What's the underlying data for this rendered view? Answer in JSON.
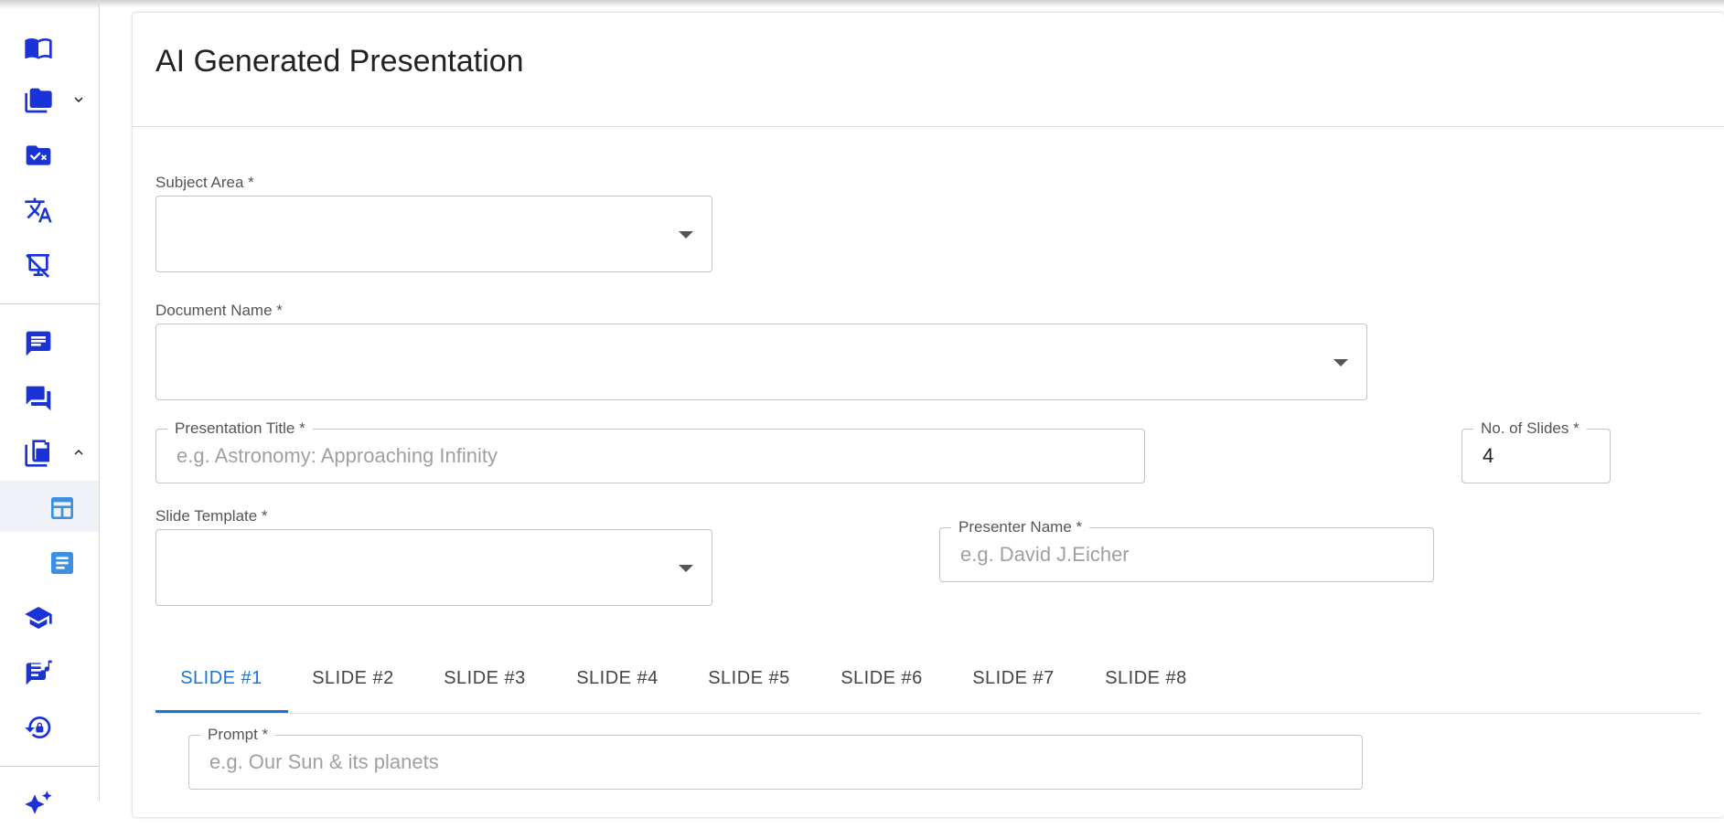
{
  "page": {
    "title": "AI Generated Presentation"
  },
  "form": {
    "subject_area": {
      "label": "Subject Area *",
      "value": ""
    },
    "document_name": {
      "label": "Document Name *",
      "value": ""
    },
    "presentation_title": {
      "label": "Presentation Title *",
      "placeholder": "e.g. Astronomy: Approaching Infinity",
      "value": ""
    },
    "num_slides": {
      "label": "No. of Slides *",
      "value": "4"
    },
    "slide_template": {
      "label": "Slide Template *",
      "value": ""
    },
    "presenter_name": {
      "label": "Presenter Name *",
      "placeholder": "e.g. David J.Eicher",
      "value": ""
    },
    "prompt": {
      "label": "Prompt *",
      "placeholder": "e.g. Our Sun & its planets",
      "value": ""
    }
  },
  "tabs": [
    {
      "label": "SLIDE #1",
      "active": true
    },
    {
      "label": "SLIDE #2"
    },
    {
      "label": "SLIDE #3"
    },
    {
      "label": "SLIDE #4"
    },
    {
      "label": "SLIDE #5"
    },
    {
      "label": "SLIDE #6"
    },
    {
      "label": "SLIDE #7"
    },
    {
      "label": "SLIDE #8"
    }
  ],
  "sidebar": {
    "icons": [
      "book-open-icon",
      "folders-icon",
      "folder-check-icon",
      "translate-icon",
      "presentation-off-icon",
      "chat-icon",
      "forum-icon",
      "library-icon",
      "slide-template-icon",
      "document-icon",
      "graduation-cap-icon",
      "music-chat-icon",
      "lock-reset-icon",
      "sparkle-icon"
    ]
  },
  "colors": {
    "accent": "#1976d2",
    "sidebar_icon": "#1a33d6",
    "sub_icon": "#3d8fe0"
  }
}
